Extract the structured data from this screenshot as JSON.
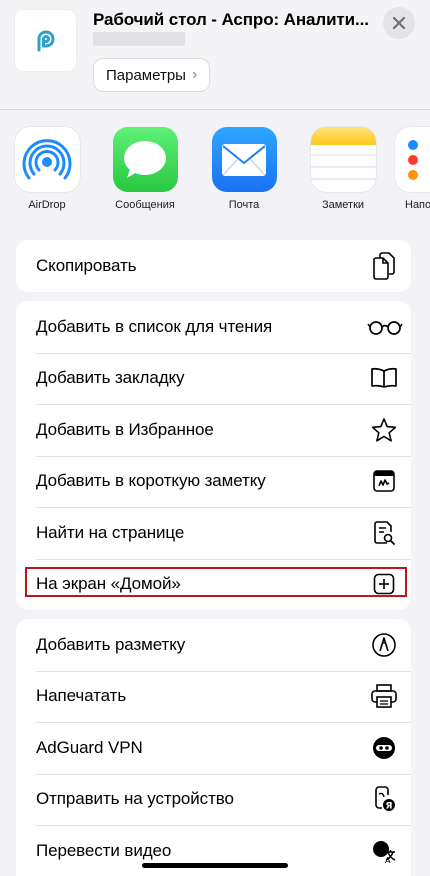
{
  "header": {
    "title": "Рабочий стол - Аспро: Аналити...",
    "params_label": "Параметры",
    "params_chevron": "›",
    "close_icon": "close-icon",
    "brand_color": "#2ba3c9"
  },
  "apps": [
    {
      "label": "AirDrop",
      "icon": "airdrop-icon"
    },
    {
      "label": "Сообщения",
      "icon": "messages-icon"
    },
    {
      "label": "Почта",
      "icon": "mail-icon"
    },
    {
      "label": "Заметки",
      "icon": "notes-icon"
    },
    {
      "label": "Напо",
      "icon": "reminders-icon"
    }
  ],
  "groups": [
    [
      {
        "label": "Скопировать",
        "icon": "copy-icon"
      }
    ],
    [
      {
        "label": "Добавить в список для чтения",
        "icon": "glasses-icon"
      },
      {
        "label": "Добавить закладку",
        "icon": "book-icon"
      },
      {
        "label": "Добавить в Избранное",
        "icon": "star-icon"
      },
      {
        "label": "Добавить в короткую заметку",
        "icon": "quick-note-icon"
      },
      {
        "label": "Найти на странице",
        "icon": "find-on-page-icon"
      },
      {
        "label": "На экран «Домой»",
        "icon": "add-square-icon"
      }
    ],
    [
      {
        "label": "Добавить разметку",
        "icon": "markup-pen-icon"
      },
      {
        "label": "Напечатать",
        "icon": "printer-icon"
      },
      {
        "label": "AdGuard VPN",
        "icon": "adguard-vpn-icon"
      },
      {
        "label": "Отправить на устройство",
        "icon": "send-to-device-icon"
      },
      {
        "label": "Перевести видео",
        "icon": "translate-video-icon"
      }
    ]
  ],
  "colors": {
    "highlight": "#c0141e",
    "messages": "#34c759",
    "mail": "#1a8cff",
    "notes": "#ffd23a",
    "airdrop": "#1a8cff"
  }
}
